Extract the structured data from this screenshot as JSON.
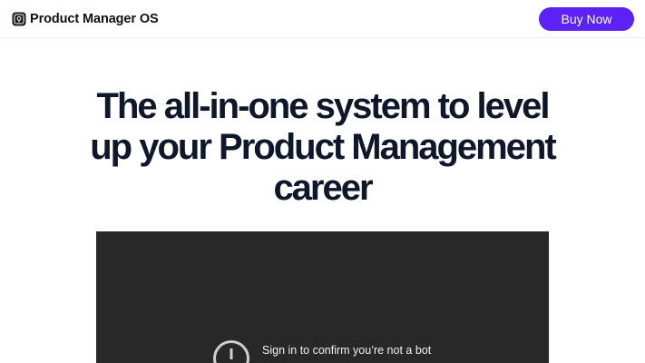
{
  "header": {
    "brand_name": "Product Manager OS",
    "brand_icon": "notion-style-cube-icon",
    "cta_label": "Buy Now"
  },
  "hero": {
    "title": "The all-in-one system to level up your Product Management career"
  },
  "video": {
    "icon": "alert-circle-icon",
    "message": "Sign in to confirm you’re not a bot"
  },
  "colors": {
    "accent": "#5b21f5",
    "title": "#0f172a",
    "video_bg": "#282828",
    "video_text": "#f1f1f1"
  }
}
